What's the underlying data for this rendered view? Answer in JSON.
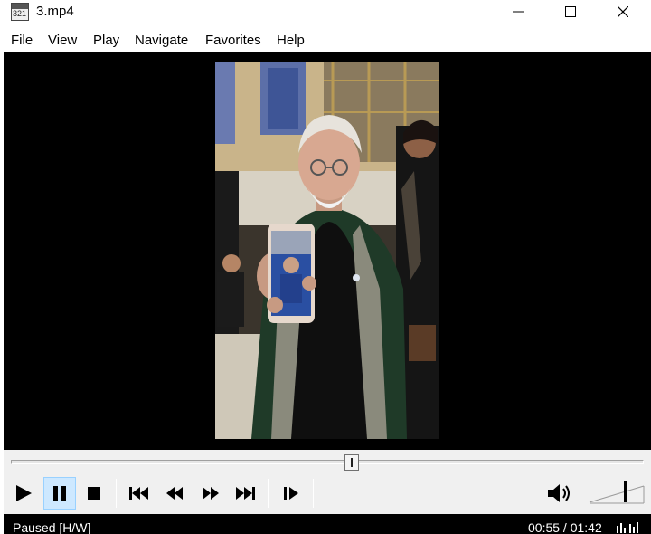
{
  "window": {
    "title": "3.mp4",
    "icon": "film-clapper-icon",
    "icon_text": "321"
  },
  "menu": {
    "items": [
      "File",
      "View",
      "Play",
      "Navigate",
      "Favorites",
      "Help"
    ]
  },
  "video": {
    "state": "paused"
  },
  "seek": {
    "progress": 0.539
  },
  "controls": {
    "buttons": [
      "play",
      "pause",
      "stop",
      "previous-chapter",
      "rewind",
      "fast-forward",
      "next-chapter",
      "frame-step"
    ],
    "active": "pause",
    "volume_icon": "speaker-icon"
  },
  "status": {
    "state_text": "Paused [H/W]",
    "time_text": "00:55 / 01:42"
  },
  "colors": {
    "status_bg": "#000000",
    "controls_bg": "#f0f0f0",
    "active_button": "#cde8ff"
  }
}
